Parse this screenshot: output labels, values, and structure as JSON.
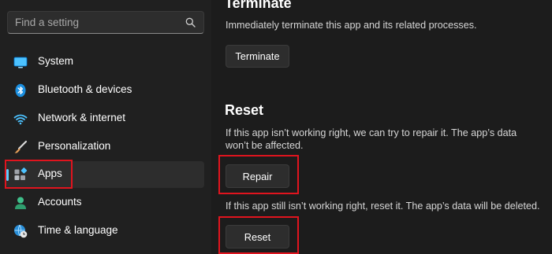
{
  "sidebar": {
    "search": {
      "placeholder": "Find a setting",
      "icon": "search-icon"
    },
    "items": [
      {
        "label": "System",
        "icon": "system-icon"
      },
      {
        "label": "Bluetooth & devices",
        "icon": "bluetooth-icon"
      },
      {
        "label": "Network & internet",
        "icon": "wifi-icon"
      },
      {
        "label": "Personalization",
        "icon": "paintbrush-icon"
      },
      {
        "label": "Apps",
        "icon": "apps-icon",
        "selected": true
      },
      {
        "label": "Accounts",
        "icon": "accounts-icon"
      },
      {
        "label": "Time & language",
        "icon": "globe-clock-icon"
      }
    ]
  },
  "main": {
    "terminate": {
      "title": "Terminate",
      "description": "Immediately terminate this app and its related processes.",
      "button": "Terminate"
    },
    "reset": {
      "title": "Reset",
      "repair_description_1": "If this app isn’t working right, we can try to repair it. The app’s data",
      "repair_description_2": "won’t be affected.",
      "repair_button": "Repair",
      "reset_description": "If this app still isn’t working right, reset it. The app’s data will be deleted.",
      "reset_button": "Reset"
    }
  },
  "colors": {
    "accent": "#60cdff",
    "highlight": "#e0141e",
    "background": "#1c1c1c",
    "sidebar": "#202020"
  }
}
